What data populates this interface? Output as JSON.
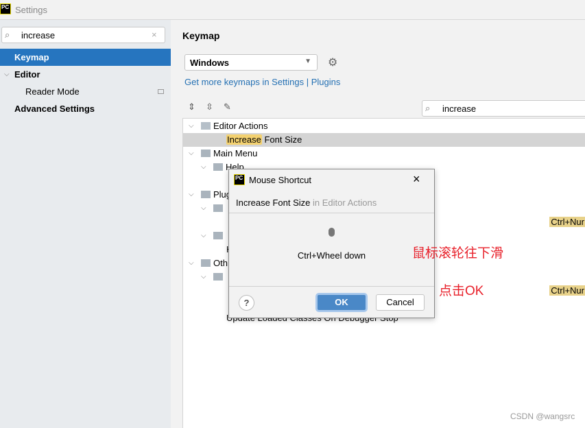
{
  "window": {
    "title": "Settings",
    "logo": "PC"
  },
  "sidebar": {
    "search_value": "increase",
    "items": [
      {
        "label": "Keymap"
      },
      {
        "label": "Editor"
      },
      {
        "label": "Reader Mode"
      },
      {
        "label": "Advanced Settings"
      }
    ]
  },
  "main": {
    "title": "Keymap",
    "keymap_select": "Windows",
    "link_text": "Get more keymaps in Settings | Plugins",
    "filter_value": "increase"
  },
  "tree": {
    "editor_actions": "Editor Actions",
    "increase_hl": "Increase",
    "increase_rest": " Font Size",
    "main_menu": "Main Menu",
    "help": "Help",
    "plugins": "Plug",
    "other": "Oth",
    "h": "H",
    "update_loaded": "Update Loaded Classes On Debugger Stop",
    "shortcut_1": "Ctrl+Nur",
    "shortcut_2": "Ctrl+Nur"
  },
  "dialog": {
    "title": "Mouse Shortcut",
    "action": "Increase Font Size",
    "context": " in Editor Actions",
    "shortcut": "Ctrl+Wheel down",
    "ok": "OK",
    "cancel": "Cancel",
    "help": "?"
  },
  "annotations": {
    "scroll": "鼠标滚轮往下滑",
    "click_ok": "点击OK"
  },
  "watermark": "CSDN @wangsrc",
  "colors": {
    "selection": "#2675bf",
    "highlight": "#f3d170",
    "ok_button": "#4a88c7",
    "annotation": "#e8202a"
  }
}
